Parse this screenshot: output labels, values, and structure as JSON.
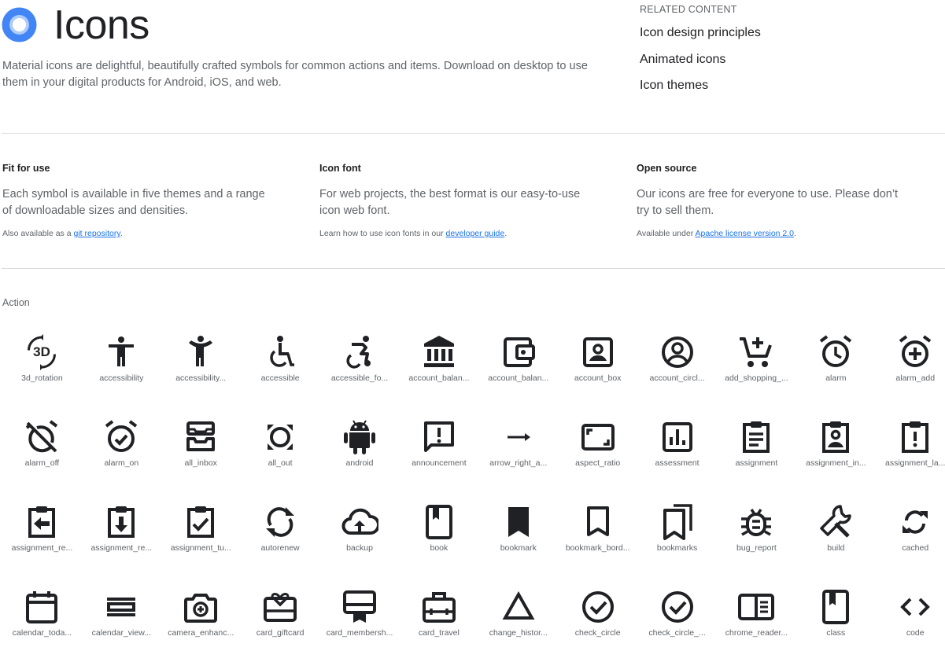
{
  "header": {
    "title": "Icons",
    "intro": "Material icons are delightful, beautifully crafted symbols for common actions and items. Download on desktop to use them in your digital products for Android, iOS, and web.",
    "brand_colors": {
      "outer": "#4285f4",
      "inner": "#ffffff",
      "ring": "#aecbfa"
    }
  },
  "related": {
    "heading": "RELATED CONTENT",
    "links": [
      "Icon design principles",
      "Animated icons",
      "Icon themes"
    ]
  },
  "features": [
    {
      "title": "Fit for use",
      "body": "Each symbol is available in five themes and a range of downloadable sizes and densities.",
      "note_prefix": "Also available as a ",
      "link": "git repository",
      "note_suffix": "."
    },
    {
      "title": "Icon font",
      "body": "For web projects, the best format is our easy-to-use icon web font.",
      "note_prefix": "Learn how to use icon fonts in our ",
      "link": "developer guide",
      "note_suffix": "."
    },
    {
      "title": "Open source",
      "body": "Our icons are free for everyone to use. Please don’t try to sell them.",
      "note_prefix": "Available under ",
      "link": "Apache license version 2.0",
      "note_suffix": "."
    }
  ],
  "section": {
    "label": "Action"
  },
  "icons": [
    {
      "label": "3d_rotation",
      "icon": "3d-rotation-icon"
    },
    {
      "label": "accessibility",
      "icon": "accessibility-icon"
    },
    {
      "label": "accessibility...",
      "icon": "accessibility-new-icon"
    },
    {
      "label": "accessible",
      "icon": "accessible-icon"
    },
    {
      "label": "accessible_fo...",
      "icon": "accessible-forward-icon"
    },
    {
      "label": "account_balan...",
      "icon": "account-balance-icon"
    },
    {
      "label": "account_balan...",
      "icon": "account-balance-wallet-icon"
    },
    {
      "label": "account_box",
      "icon": "account-box-icon"
    },
    {
      "label": "account_circl...",
      "icon": "account-circle-icon"
    },
    {
      "label": "add_shopping_...",
      "icon": "add-shopping-cart-icon"
    },
    {
      "label": "alarm",
      "icon": "alarm-icon"
    },
    {
      "label": "alarm_add",
      "icon": "alarm-add-icon"
    },
    {
      "label": "alarm_off",
      "icon": "alarm-off-icon"
    },
    {
      "label": "alarm_on",
      "icon": "alarm-on-icon"
    },
    {
      "label": "all_inbox",
      "icon": "all-inbox-icon"
    },
    {
      "label": "all_out",
      "icon": "all-out-icon"
    },
    {
      "label": "android",
      "icon": "android-icon"
    },
    {
      "label": "announcement",
      "icon": "announcement-icon"
    },
    {
      "label": "arrow_right_a...",
      "icon": "arrow-right-alt-icon"
    },
    {
      "label": "aspect_ratio",
      "icon": "aspect-ratio-icon"
    },
    {
      "label": "assessment",
      "icon": "assessment-icon"
    },
    {
      "label": "assignment",
      "icon": "assignment-icon"
    },
    {
      "label": "assignment_in...",
      "icon": "assignment-ind-icon"
    },
    {
      "label": "assignment_la...",
      "icon": "assignment-late-icon"
    },
    {
      "label": "assignment_re...",
      "icon": "assignment-return-icon"
    },
    {
      "label": "assignment_re...",
      "icon": "assignment-returned-icon"
    },
    {
      "label": "assignment_tu...",
      "icon": "assignment-turned-in-icon"
    },
    {
      "label": "autorenew",
      "icon": "autorenew-icon"
    },
    {
      "label": "backup",
      "icon": "backup-icon"
    },
    {
      "label": "book",
      "icon": "book-icon"
    },
    {
      "label": "bookmark",
      "icon": "bookmark-icon"
    },
    {
      "label": "bookmark_bord...",
      "icon": "bookmark-border-icon"
    },
    {
      "label": "bookmarks",
      "icon": "bookmarks-icon"
    },
    {
      "label": "bug_report",
      "icon": "bug-report-icon"
    },
    {
      "label": "build",
      "icon": "build-icon"
    },
    {
      "label": "cached",
      "icon": "cached-icon"
    },
    {
      "label": "calendar_toda...",
      "icon": "calendar-today-icon"
    },
    {
      "label": "calendar_view...",
      "icon": "calendar-view-day-icon"
    },
    {
      "label": "camera_enhanc...",
      "icon": "camera-enhance-icon"
    },
    {
      "label": "card_giftcard",
      "icon": "card-giftcard-icon"
    },
    {
      "label": "card_membersh...",
      "icon": "card-membership-icon"
    },
    {
      "label": "card_travel",
      "icon": "card-travel-icon"
    },
    {
      "label": "change_histor...",
      "icon": "change-history-icon"
    },
    {
      "label": "check_circle",
      "icon": "check-circle-icon"
    },
    {
      "label": "check_circle_...",
      "icon": "check-circle-outline-icon"
    },
    {
      "label": "chrome_reader...",
      "icon": "chrome-reader-mode-icon"
    },
    {
      "label": "class",
      "icon": "class-icon"
    },
    {
      "label": "code",
      "icon": "code-icon"
    }
  ]
}
